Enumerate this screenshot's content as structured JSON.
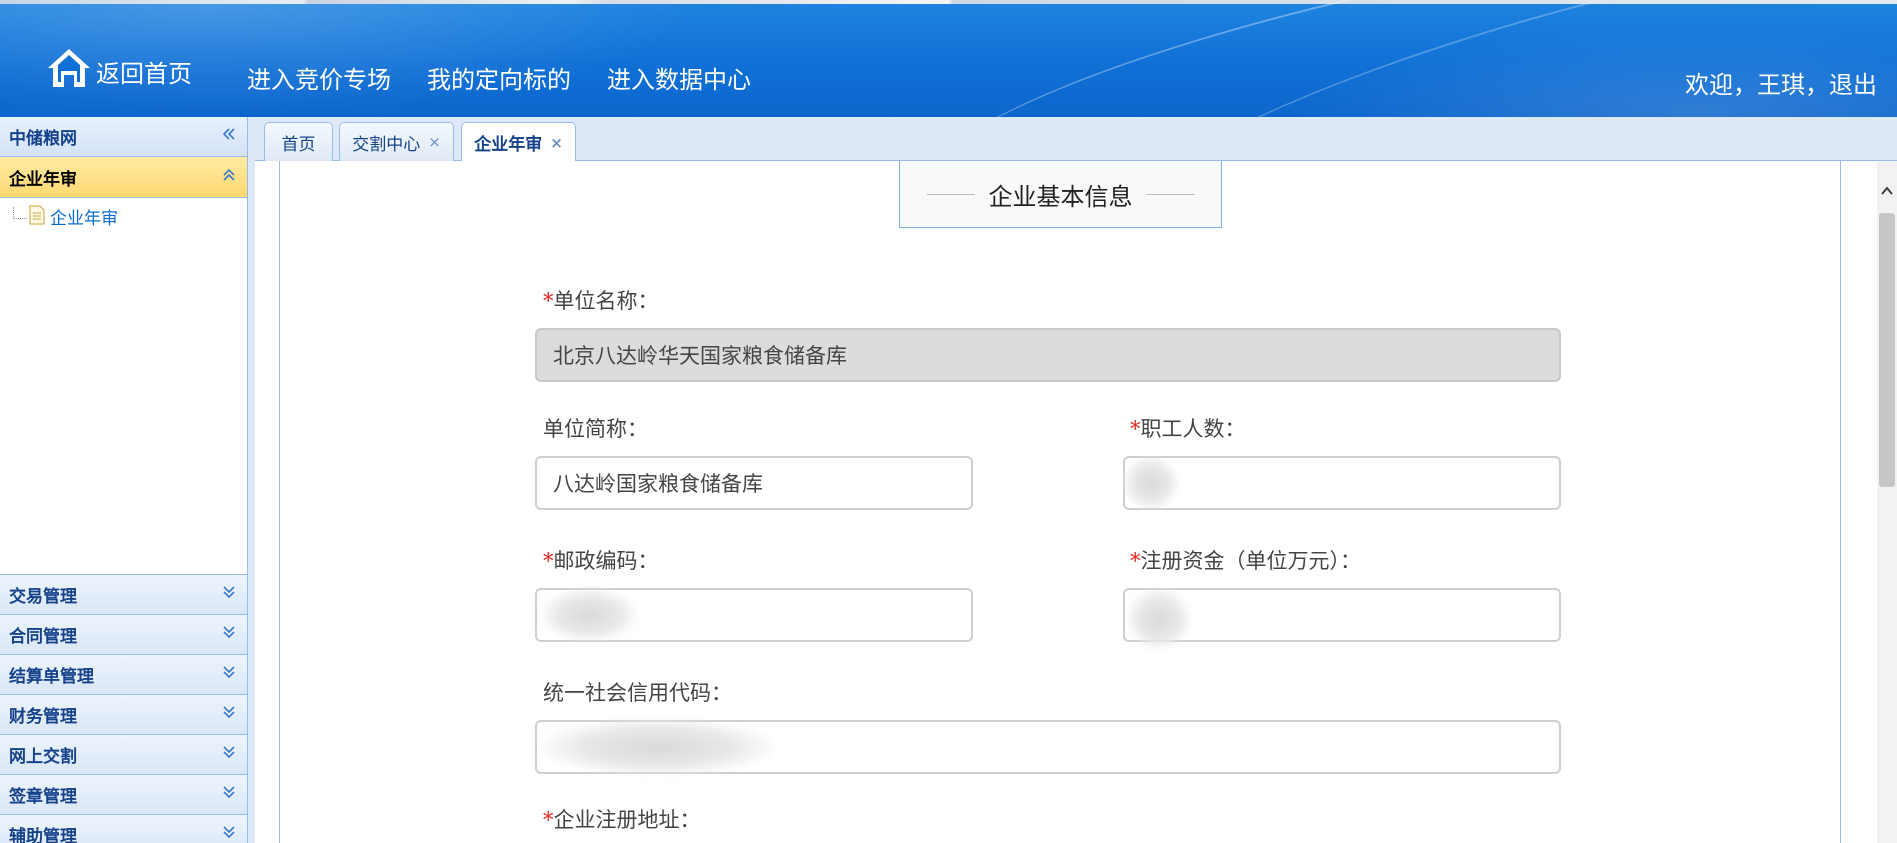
{
  "header": {
    "home_label": "返回首页",
    "nav": [
      "进入竞价专场",
      "我的定向标的",
      "进入数据中心"
    ],
    "welcome": "欢迎，王琪，",
    "logout": "退出"
  },
  "sidebar": {
    "title": "中储粮网",
    "active_section": "企业年审",
    "tree_items": [
      "企业年审"
    ],
    "sections": [
      "交易管理",
      "合同管理",
      "结算单管理",
      "财务管理",
      "网上交割",
      "签章管理",
      "辅助管理"
    ]
  },
  "tabs": [
    {
      "label": "首页",
      "closable": false,
      "active": false
    },
    {
      "label": "交割中心",
      "closable": true,
      "active": false
    },
    {
      "label": "企业年审",
      "closable": true,
      "active": true
    }
  ],
  "tab_close_glyph": "×",
  "form": {
    "section_title": "企业基本信息",
    "required_mark": "*",
    "unit_name_label": "单位名称：",
    "unit_name_value": "北京八达岭华天国家粮食储备库",
    "short_name_label": "单位简称：",
    "short_name_value": "八达岭国家粮食储备库",
    "staff_label": "职工人数：",
    "staff_value": "",
    "postcode_label": "邮政编码：",
    "postcode_value": "",
    "capital_label": "注册资金（单位万元）：",
    "capital_value": "",
    "credit_code_label": "统一社会信用代码：",
    "credit_code_value": "",
    "address_label": "企业注册地址："
  },
  "colors": {
    "header_blue": "#1070d6",
    "sidebar_header_text": "#15428b",
    "active_section_bg": "#ffd970",
    "link_blue": "#0b6bcf",
    "required_red": "#e2231a",
    "border_blue": "#99bbe8"
  },
  "icons": [
    "home-icon",
    "double-chevron-left-icon",
    "double-chevron-up-icon",
    "double-chevron-down-icon",
    "document-icon",
    "close-icon",
    "scroll-up-icon"
  ]
}
